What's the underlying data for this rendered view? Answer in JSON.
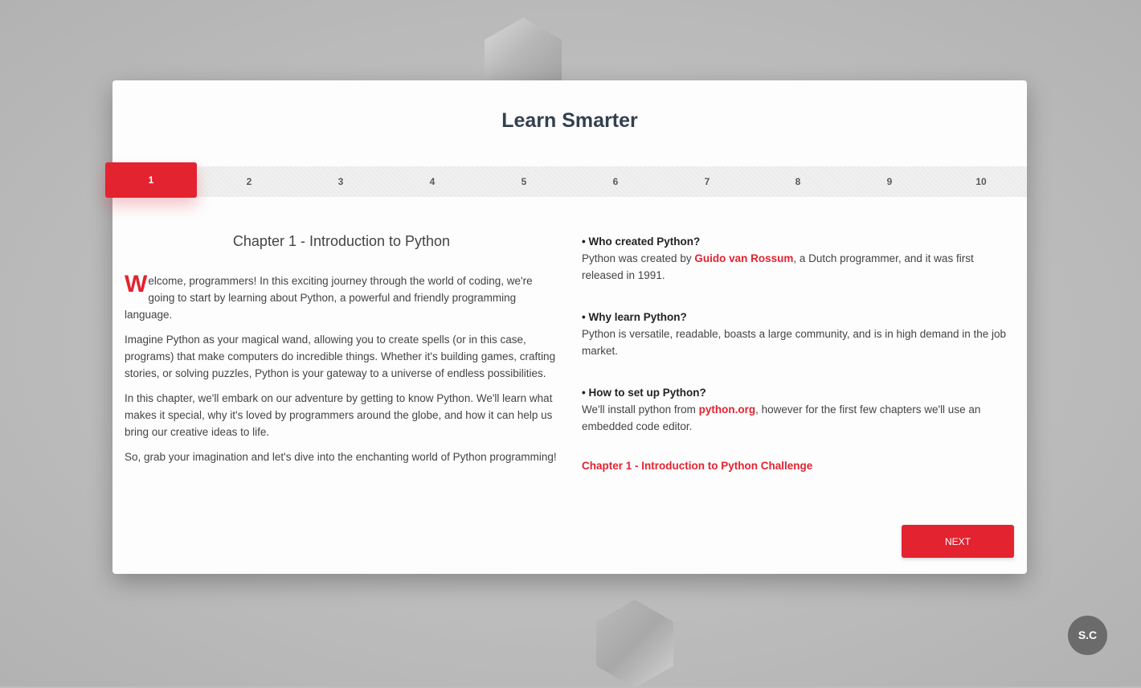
{
  "title": "Learn Smarter",
  "steps": {
    "active": "1",
    "items": [
      "2",
      "3",
      "4",
      "5",
      "6",
      "7",
      "8",
      "9",
      "10"
    ]
  },
  "chapter": {
    "title": "Chapter 1 - Introduction to Python",
    "dropcap": "W",
    "intro": "elcome, programmers! In this exciting journey through the world of coding, we're going to start by learning about Python, a powerful and friendly programming language.",
    "paragraphs": [
      "Imagine Python as your magical wand, allowing you to create spells (or in this case, programs) that make computers do incredible things. Whether it's building games, crafting stories, or solving puzzles, Python is your gateway to a universe of endless possibilities.",
      "In this chapter, we'll embark on our adventure by getting to know Python. We'll learn what makes it special, why it's loved by programmers around the globe, and how it can help us bring our creative ideas to life.",
      "So, grab your imagination and let's dive into the enchanting world of Python programming!"
    ]
  },
  "faq": {
    "q1": "• Who created Python?",
    "a1_pre": "Python was created by ",
    "a1_link": "Guido van Rossum",
    "a1_post": ", a Dutch programmer, and it was first released in 1991.",
    "q2": "• Why learn Python?",
    "a2": "Python is versatile, readable, boasts a large community, and is in high demand in the job market.",
    "q3": "• How to set up Python?",
    "a3_pre": "We'll install python from ",
    "a3_link": "python.org",
    "a3_post": ", however for the first few chapters we'll use an embedded code editor.",
    "challenge": "Chapter 1 - Introduction to Python Challenge"
  },
  "next_label": "NEXT",
  "badge": "S.C",
  "colors": {
    "accent": "#e32330",
    "title": "#34404f"
  }
}
